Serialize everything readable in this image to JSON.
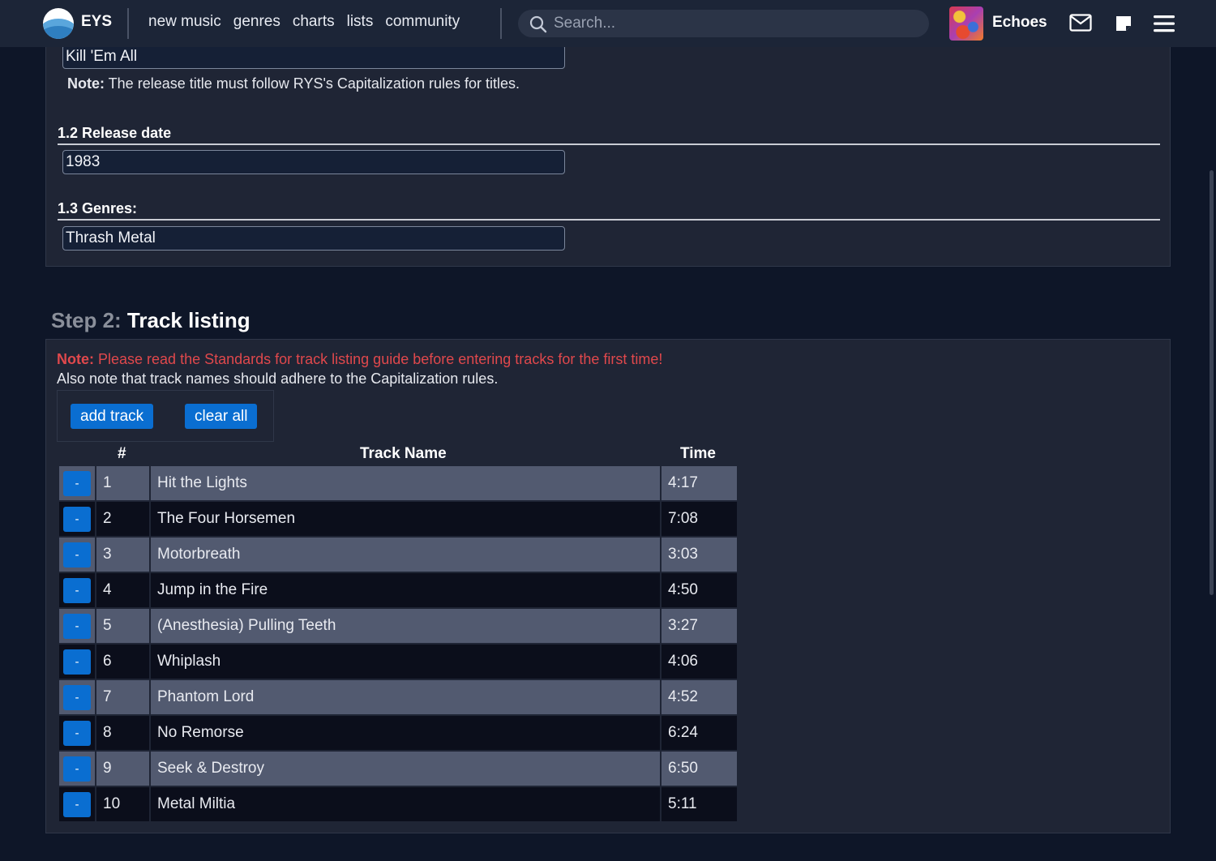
{
  "nav": {
    "brand": "EYS",
    "links": [
      "new music",
      "genres",
      "charts",
      "lists",
      "community"
    ],
    "search_placeholder": "Search...",
    "username": "Echoes"
  },
  "section1": {
    "title_value": "Kill 'Em All",
    "title_note_bold": "Note:",
    "title_note_text": " The release title must follow RYS's Capitalization rules for titles.",
    "release_date_label": "1.2 Release date",
    "release_date_value": "1983",
    "genres_label": "1.3 Genres:",
    "genres_value": "Thrash Metal"
  },
  "step2": {
    "prefix": "Step 2:",
    "title": "Track listing",
    "warn_bold": "Note:",
    "warn_text": " Please read the Standards for track listing guide before entering tracks for the first time!",
    "info": "Also note that track names should adhere to the Capitalization rules.",
    "add_label": "add track",
    "clear_label": "clear all",
    "col_num": "#",
    "col_name": "Track Name",
    "col_time": "Time",
    "remove_label": "-",
    "tracks": [
      {
        "num": "1",
        "name": "Hit the Lights",
        "time": "4:17"
      },
      {
        "num": "2",
        "name": "The Four Horsemen",
        "time": "7:08"
      },
      {
        "num": "3",
        "name": "Motorbreath",
        "time": "3:03"
      },
      {
        "num": "4",
        "name": "Jump in the Fire",
        "time": "4:50"
      },
      {
        "num": "5",
        "name": "(Anesthesia) Pulling Teeth",
        "time": "3:27"
      },
      {
        "num": "6",
        "name": "Whiplash",
        "time": "4:06"
      },
      {
        "num": "7",
        "name": "Phantom Lord",
        "time": "4:52"
      },
      {
        "num": "8",
        "name": "No Remorse",
        "time": "6:24"
      },
      {
        "num": "9",
        "name": "Seek & Destroy",
        "time": "6:50"
      },
      {
        "num": "10",
        "name": "Metal Miltia",
        "time": "5:11"
      }
    ]
  },
  "colors": {
    "accent": "#0a6ed1",
    "warning": "#e0484c",
    "row_alt": "#525a70",
    "row_dark": "#0b0e1b"
  }
}
